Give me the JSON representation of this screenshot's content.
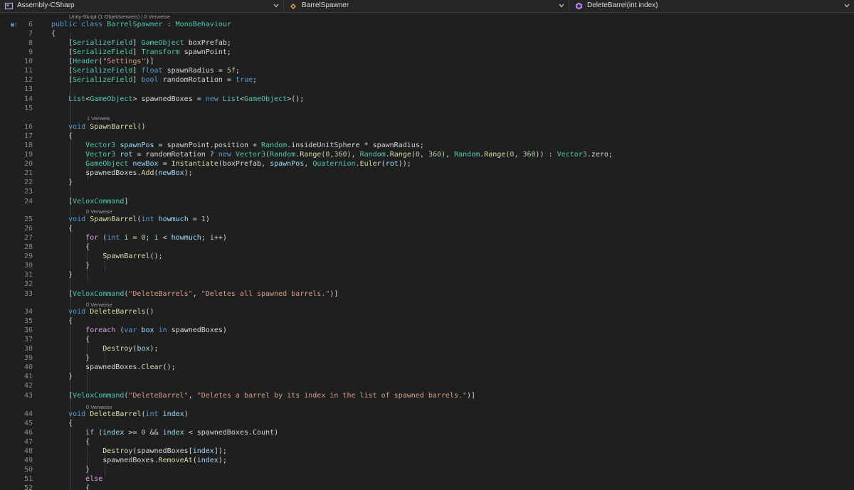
{
  "navbar": {
    "project": "Assembly-CSharp",
    "class_name": "BarrelSpawner",
    "member": "DeleteBarrel(int index)"
  },
  "codelens": {
    "class_lens": "Unity-Skript (1 Objektverweis) | 0 Verweise",
    "spawnbarrel_lens": "1 Verweis",
    "spawnbarrel_int_lens": "0 Verweise",
    "deletebarrels_lens": "0 Verweise",
    "deletebarrel_lens": "0 Verweise"
  },
  "lines": [
    {
      "n": "6",
      "text": "public class BarrelSpawner : MonoBehaviour"
    },
    {
      "n": "7",
      "text": "{"
    },
    {
      "n": "8",
      "text": "    [SerializeField] GameObject boxPrefab;"
    },
    {
      "n": "9",
      "text": "    [SerializeField] Transform spawnPoint;"
    },
    {
      "n": "10",
      "text": "    [Header(\"Settings\")]"
    },
    {
      "n": "11",
      "text": "    [SerializeField] float spawnRadius = 5f;"
    },
    {
      "n": "12",
      "text": "    [SerializeField] bool randomRotation = true;"
    },
    {
      "n": "13",
      "text": ""
    },
    {
      "n": "14",
      "text": "    List<GameObject> spawnedBoxes = new List<GameObject>();"
    },
    {
      "n": "15",
      "text": ""
    },
    {
      "n": "16",
      "text": "    void SpawnBarrel()"
    },
    {
      "n": "17",
      "text": "    {"
    },
    {
      "n": "18",
      "text": "        Vector3 spawnPos = spawnPoint.position + Random.insideUnitSphere * spawnRadius;"
    },
    {
      "n": "19",
      "text": "        Vector3 rot = randomRotation ? new Vector3(Random.Range(0,360), Random.Range(0, 360), Random.Range(0, 360)) : Vector3.zero;"
    },
    {
      "n": "20",
      "text": "        GameObject newBox = Instantiate(boxPrefab, spawnPos, Quaternion.Euler(rot));"
    },
    {
      "n": "21",
      "text": "        spawnedBoxes.Add(newBox);"
    },
    {
      "n": "22",
      "text": "    }"
    },
    {
      "n": "23",
      "text": ""
    },
    {
      "n": "24",
      "text": "    [VeloxCommand]"
    },
    {
      "n": "25",
      "text": "    void SpawnBarrel(int howmuch = 1)"
    },
    {
      "n": "26",
      "text": "    {"
    },
    {
      "n": "27",
      "text": "        for (int i = 0; i < howmuch; i++)"
    },
    {
      "n": "28",
      "text": "        {"
    },
    {
      "n": "29",
      "text": "            SpawnBarrel();"
    },
    {
      "n": "30",
      "text": "        }"
    },
    {
      "n": "31",
      "text": "    }"
    },
    {
      "n": "32",
      "text": ""
    },
    {
      "n": "33",
      "text": "    [VeloxCommand(\"DeleteBarrels\", \"Deletes all spawned barrels.\")]"
    },
    {
      "n": "34",
      "text": "    void DeleteBarrels()"
    },
    {
      "n": "35",
      "text": "    {"
    },
    {
      "n": "36",
      "text": "        foreach (var box in spawnedBoxes)"
    },
    {
      "n": "37",
      "text": "        {"
    },
    {
      "n": "38",
      "text": "            Destroy(box);"
    },
    {
      "n": "39",
      "text": "        }"
    },
    {
      "n": "40",
      "text": "        spawnedBoxes.Clear();"
    },
    {
      "n": "41",
      "text": "    }"
    },
    {
      "n": "42",
      "text": ""
    },
    {
      "n": "43",
      "text": "    [VeloxCommand(\"DeleteBarrel\", \"Deletes a barrel by its index in the list of spawned barrels.\")]"
    },
    {
      "n": "44",
      "text": "    void DeleteBarrel(int index)"
    },
    {
      "n": "45",
      "text": "    {"
    },
    {
      "n": "46",
      "text": "        if (index >= 0 && index < spawnedBoxes.Count)"
    },
    {
      "n": "47",
      "text": "        {"
    },
    {
      "n": "48",
      "text": "            Destroy(spawnedBoxes[index]);"
    },
    {
      "n": "49",
      "text": "            spawnedBoxes.RemoveAt(index);"
    },
    {
      "n": "50",
      "text": "        }"
    },
    {
      "n": "51",
      "text": "        else"
    },
    {
      "n": "52",
      "text": "        {"
    }
  ]
}
